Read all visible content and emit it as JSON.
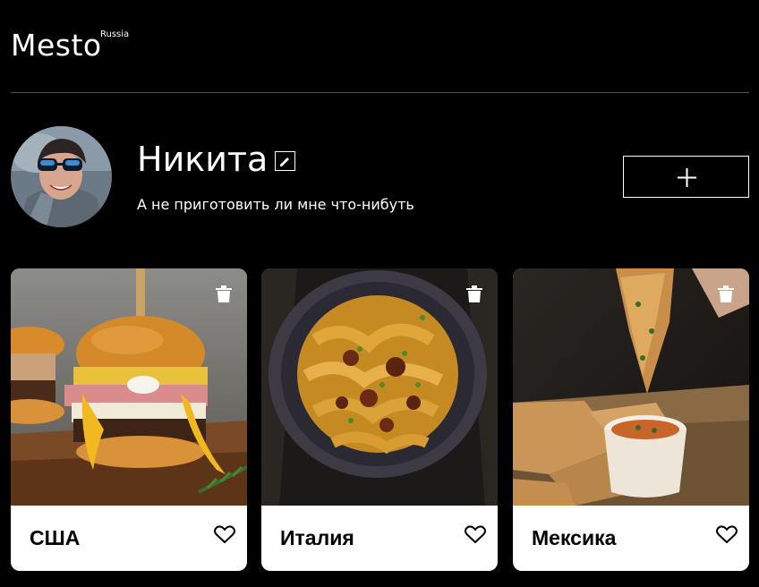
{
  "header": {
    "logo": "Mesto",
    "logo_sub": "Russia"
  },
  "profile": {
    "name": "Никита",
    "about": "А не приготовить ли мне что-нибуть",
    "edit_icon": "pencil-icon",
    "add_icon": "plus-icon"
  },
  "cards": [
    {
      "title": "США",
      "image": "burger-photo"
    },
    {
      "title": "Италия",
      "image": "pasta-photo"
    },
    {
      "title": "Мексика",
      "image": "quesadilla-photo"
    }
  ],
  "colors": {
    "background": "#000000",
    "card": "#ffffff",
    "divider": "#545454"
  }
}
